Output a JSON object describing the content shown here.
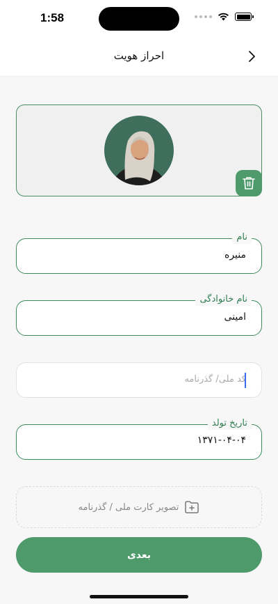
{
  "status_bar": {
    "time": "1:58"
  },
  "header": {
    "title": "احراز هویت",
    "back_icon": "chevron-right-icon"
  },
  "photo_card": {
    "avatar": "user-avatar-photo",
    "delete_icon": "trash-icon",
    "accent_color": "#4f9a6b"
  },
  "fields": {
    "first_name": {
      "label": "نام",
      "value": "منیره"
    },
    "last_name": {
      "label": "نام خانوادگی",
      "value": "امینی"
    },
    "national_id": {
      "placeholder": "کد ملی/ گذرنامه",
      "value": ""
    },
    "birth_date": {
      "label": "تاریخ تولد",
      "value": "۱۳۷۱-۰۴-۰۴"
    }
  },
  "upload": {
    "label": "تصویر کارت ملی / گذرنامه",
    "icon": "folder-add-icon"
  },
  "next_button": {
    "label": "بعدی"
  }
}
